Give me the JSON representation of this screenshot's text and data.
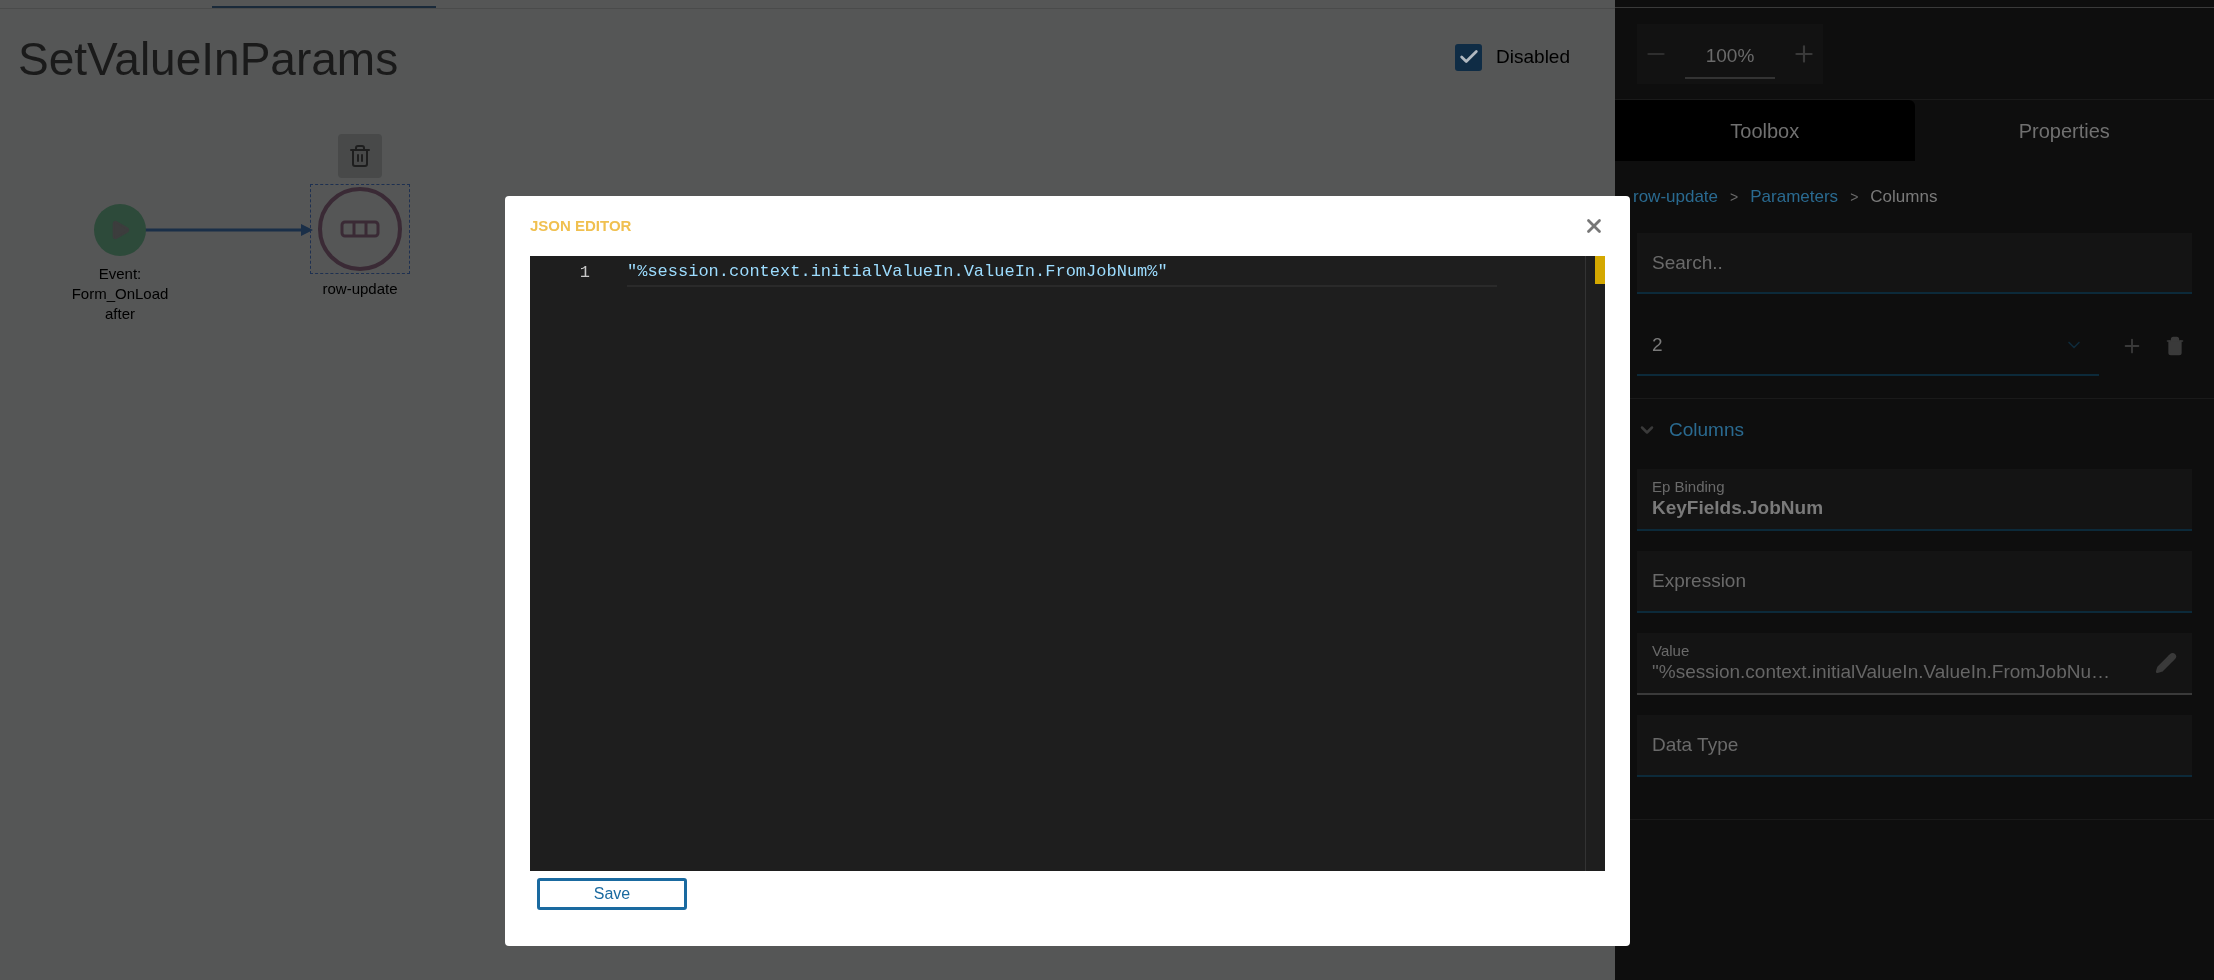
{
  "canvas": {
    "title": "SetValueInParams",
    "disabled_toggle": {
      "label": "Disabled",
      "checked": true
    },
    "nodes": [
      {
        "kind": "event",
        "label": "Event: Form_OnLoad after"
      },
      {
        "kind": "action",
        "label": "row-update",
        "selected": true
      }
    ]
  },
  "panel": {
    "zoom": {
      "value": "100%"
    },
    "tabs": [
      {
        "label": "Toolbox",
        "selected": true
      },
      {
        "label": "Properties",
        "selected": false
      }
    ],
    "breadcrumb": [
      {
        "kind": "link",
        "label": "row-update"
      },
      {
        "kind": "separator",
        "label": ">"
      },
      {
        "kind": "link",
        "label": "Parameters"
      },
      {
        "kind": "separator",
        "label": ">"
      },
      {
        "kind": "current",
        "label": "Columns"
      }
    ],
    "search": {
      "placeholder": "Search.."
    },
    "select": {
      "value": "2"
    },
    "section": {
      "title": "Columns",
      "expanded": true
    },
    "fields": [
      {
        "kind": "text",
        "label": "Ep Binding",
        "value": "KeyFields.JobNum"
      },
      {
        "kind": "text",
        "label": "Expression"
      },
      {
        "kind": "editor",
        "label": "Value",
        "value": "\"%session.context.initialValueIn.ValueIn.FromJobNu…"
      },
      {
        "kind": "text",
        "label": "Data Type"
      }
    ]
  },
  "modal": {
    "title": "JSON EDITOR",
    "lines": [
      {
        "number": "1",
        "text": "\"%session.context.initialValueIn.ValueIn.FromJobNum%\""
      }
    ],
    "save": "Save"
  }
}
